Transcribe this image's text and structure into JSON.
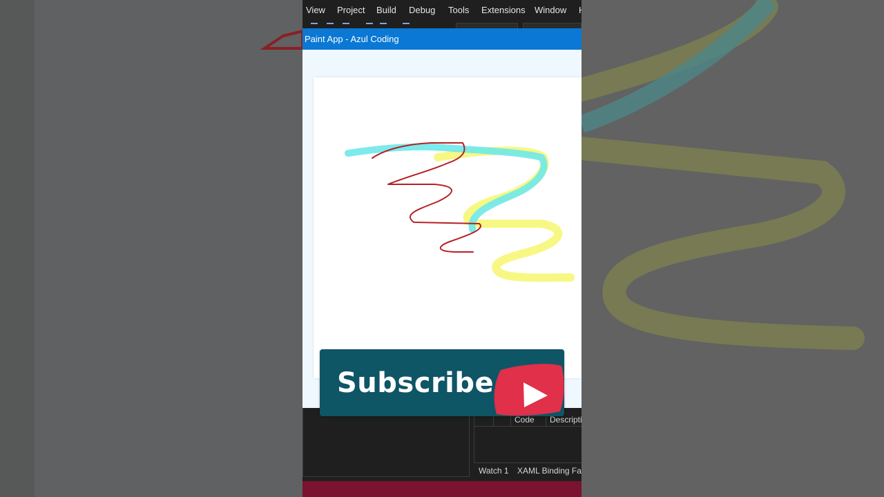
{
  "menu": {
    "items": [
      "View",
      "Project",
      "Build",
      "Debug",
      "Tools",
      "Extensions",
      "Window",
      "H"
    ]
  },
  "app": {
    "title": "Paint App - Azul Coding",
    "strokes": [
      {
        "name": "cyan-stroke",
        "color": "#6fe8ea"
      },
      {
        "name": "yellow-stroke",
        "color": "#f6f77a"
      },
      {
        "name": "red-stroke",
        "color": "#b51f24"
      }
    ]
  },
  "error_list": {
    "columns": [
      "Code",
      "Descripti"
    ]
  },
  "bottom_tabs": [
    "Watch 1",
    "XAML Binding Fai"
  ],
  "subscribe": {
    "label": "Subscribe",
    "badge_color": "#0e5566",
    "play_color": "#e0304a",
    "icon": "play-icon"
  },
  "colors": {
    "titlebar": "#0a78d4",
    "status_bar": "#7a1230"
  }
}
